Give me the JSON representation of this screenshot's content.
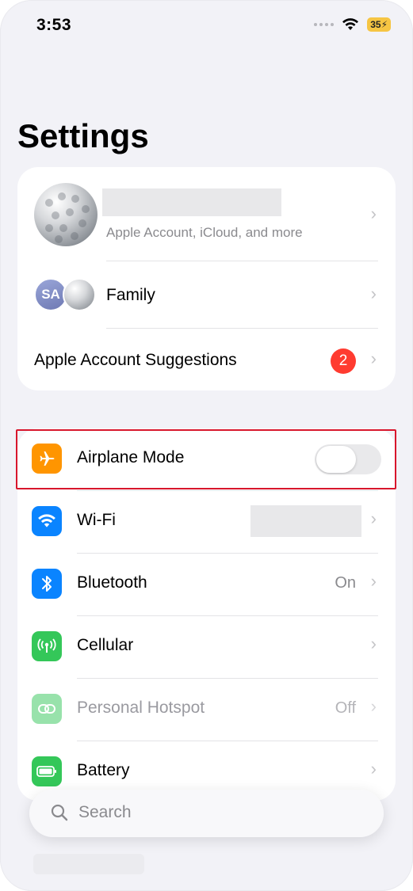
{
  "status_bar": {
    "time": "3:53",
    "battery_level": "35"
  },
  "page_title": "Settings",
  "account": {
    "subtitle": "Apple Account, iCloud, and more",
    "family_label": "Family",
    "family_initials": "SA",
    "suggestions_label": "Apple Account Suggestions",
    "suggestions_count": "2"
  },
  "settings": {
    "airplane": {
      "label": "Airplane Mode",
      "enabled": false,
      "icon": "airplane-icon",
      "color": "#ff9500"
    },
    "wifi": {
      "label": "Wi-Fi",
      "icon": "wifi-icon",
      "color": "#0a84ff"
    },
    "bluetooth": {
      "label": "Bluetooth",
      "value": "On",
      "icon": "bluetooth-icon",
      "color": "#0a84ff"
    },
    "cellular": {
      "label": "Cellular",
      "icon": "antenna-icon",
      "color": "#34c759"
    },
    "hotspot": {
      "label": "Personal Hotspot",
      "value": "Off",
      "icon": "link-icon",
      "color": "#34c759"
    },
    "battery": {
      "label": "Battery",
      "icon": "battery-icon",
      "color": "#34c759"
    }
  },
  "search": {
    "placeholder": "Search"
  },
  "colors": {
    "highlight": "#d8162c",
    "badge": "#ff3b30"
  }
}
